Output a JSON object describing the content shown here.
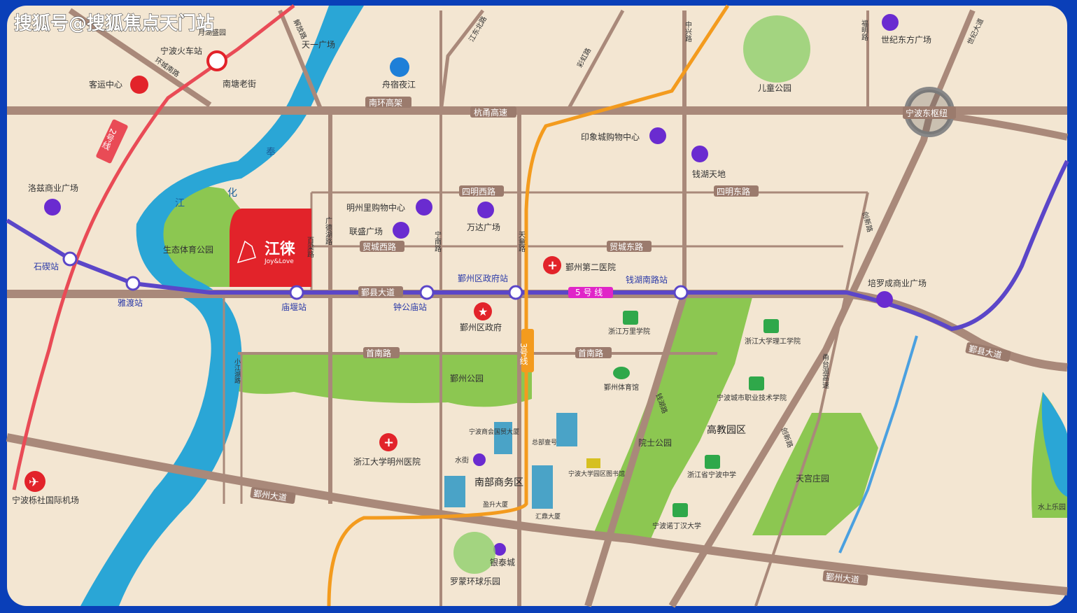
{
  "watermark": "搜狐号@搜狐焦点天门站",
  "project": {
    "name": "江徕",
    "name_en": "Joy&Love"
  },
  "metro": {
    "line5": "5 号 线",
    "line3": "3号线",
    "line2": "2号线",
    "stations": [
      "石碶站",
      "雅渡站",
      "庙堰站",
      "钟公庙站",
      "鄞州区政府站",
      "钱湖南路站"
    ]
  },
  "roads": {
    "nanhuan": "南环高架",
    "hangyong": "杭甬高速",
    "siming_west": "四明西路",
    "siming_east": "四明东路",
    "maocheng_west": "贸城西路",
    "maocheng_east": "贸城东路",
    "yinxian": "鄞县大道",
    "yinxian_east": "鄞县大道",
    "shounan_w": "首南路",
    "shounan_e": "首南路",
    "yinzhou_w": "鄞州大道",
    "yinzhou_e": "鄞州大道",
    "huancheng_south": "环城南路",
    "jiefang": "解放路",
    "jiangdong": "江东北路",
    "caihong": "彩虹路",
    "zhongxing": "中兴路",
    "fuming": "福明路",
    "shiji": "世纪大道",
    "guangde": "广德湖路",
    "bailiang": "百梁路",
    "ningnan": "宁南路",
    "tiantong": "天童路",
    "qianhu": "钱湖路",
    "chuangxin1": "创新路",
    "chuangxin2": "创新路",
    "nantai": "甬台温高速",
    "xiaojiang": "小江湖路",
    "hub": "宁波东枢纽"
  },
  "river": [
    "奉",
    "化",
    "江"
  ],
  "pois": {
    "yuehu": "月湖盛园",
    "tianyi": "天一广场",
    "train": "宁波火车站",
    "bus": "客运中心",
    "nantang": "南塘老街",
    "zhouzhai": "舟宿夜江",
    "children": "儿童公园",
    "shijidongfang": "世纪东方广场",
    "yinxiang": "印象城购物中心",
    "qianhu_tiandi": "钱湖天地",
    "luozi": "洛兹商业广场",
    "mingzhouli": "明州里购物中心",
    "lianshang": "联盛广场",
    "wanda": "万达广场",
    "eco_park": "生态体育公园",
    "hospital2": "鄞州第二医院",
    "gov": "鄞州区政府",
    "peiluocheng": "培罗成商业广场",
    "wanli": "浙江万里学院",
    "ligong": "浙江大学理工学院",
    "stadium": "鄞州体育馆",
    "vocational": "宁波城市职业技术学院",
    "yinzhou_park": "鄞州公园",
    "chamber": "宁波商会国贸大厦",
    "hq": "总部壹号",
    "water_street": "水街",
    "mingzhou_hospital": "浙江大学明州医院",
    "cbd": "南部商务区",
    "library": "宁波大学园区图书馆",
    "huiding": "汇鼎大厦",
    "yingsheng": "盈升大厦",
    "yuanshi": "院士公园",
    "gaojiao": "高教园区",
    "ningbo_middle": "浙江省宁波中学",
    "nottingham": "宁波诺丁汉大学",
    "tiangong": "天宫庄园",
    "airport": "宁波栎社国际机场",
    "yintai": "银泰城",
    "romon": "罗蒙环球乐园",
    "shuishang": "水上乐园"
  },
  "colors": {
    "land": "#f3e6d2",
    "road": "#a9897a",
    "river": "#2aa6d6",
    "metro5": "#5b46c8",
    "metro3": "#f39b1e",
    "metro2": "#e94b56",
    "green": "#6fbf3f",
    "frame": "#0a3fb8",
    "project": "#e2232a"
  }
}
